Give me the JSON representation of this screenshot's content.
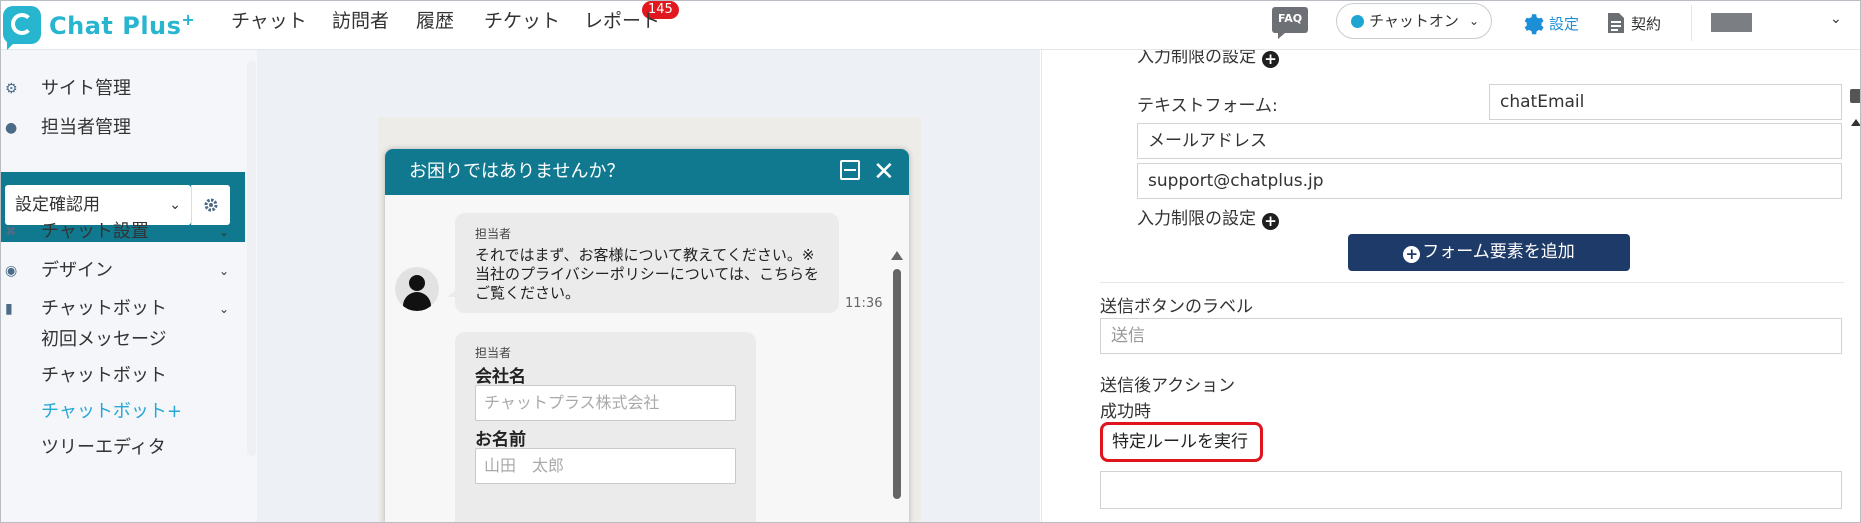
{
  "app": {
    "logo_text": "Chat Plus",
    "logo_sup": "+"
  },
  "nav": {
    "items": [
      "チャット",
      "訪問者",
      "履歴",
      "チケット",
      "レポート"
    ],
    "ticket_badge": "145"
  },
  "header": {
    "faq_label": "FAQ",
    "chat_status": "チャットオン",
    "settings_label": "設定",
    "contract_label": "契約"
  },
  "sidebar": {
    "items": [
      {
        "label": "サイト管理",
        "icon": "gear-icon"
      },
      {
        "label": "担当者管理",
        "icon": "users-icon"
      }
    ],
    "site_select": "設定確認用",
    "sections": [
      {
        "label": "チャット設置",
        "icon": "tools-icon"
      },
      {
        "label": "デザイン",
        "icon": "palette-icon"
      },
      {
        "label": "チャットボット",
        "icon": "chat-icon"
      }
    ],
    "sub_items": [
      "初回メッセージ",
      "チャットボット",
      "チャットボット+",
      "ツリーエディタ"
    ],
    "active_sub": "チャットボット+"
  },
  "widget": {
    "title": "お困りではありませんか？",
    "message1": {
      "sender": "担当者",
      "text": "それではまず、お客様について教えてください。※当社のプライバシーポリシーについては、こちらをご覧ください。",
      "time": "11:36"
    },
    "message2": {
      "sender": "担当者",
      "company_label": "会社名",
      "company_placeholder": "チャットプラス株式会社",
      "name_label": "お名前",
      "name_placeholder": "山田　太郎"
    }
  },
  "panel": {
    "input_restriction_top": "入力制限の設定",
    "text_form_label": "テキストフォーム:",
    "text_form_value": "chatEmail",
    "field_label_value": "メールアドレス",
    "field_placeholder_value": "support@chatplus.jp",
    "input_restriction": "入力制限の設定",
    "add_form_button": "フォーム要素を追加",
    "send_button_label_title": "送信ボタンのラベル",
    "send_button_placeholder": "送信",
    "after_send_action": "送信後アクション",
    "on_success": "成功時",
    "success_select": "特定ルールを実行",
    "success_extra_value": ""
  },
  "colors": {
    "brand": "#27b5cf",
    "widget_header": "#10798f",
    "add_button": "#1e3a68",
    "badge": "#e1191f",
    "highlight": "#e0141c"
  }
}
